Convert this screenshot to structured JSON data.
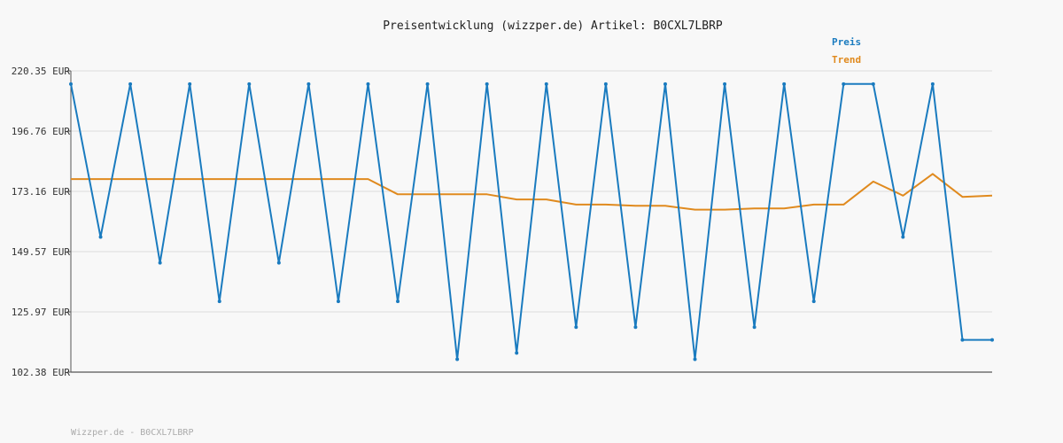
{
  "chart_data": {
    "type": "line",
    "title": "Preisentwicklung (wizzper.de) Artikel: B0CXL7LBRP",
    "footer": "Wizzper.de - B0CXL7LBRP",
    "ylim": [
      102.38,
      220.35
    ],
    "yticks": [
      "220.35 EUR",
      "196.76 EUR",
      "173.16 EUR",
      "149.57 EUR",
      "125.97 EUR",
      "102.38 EUR"
    ],
    "grid": true,
    "legend_position": "top-right",
    "series": [
      {
        "name": "Preis",
        "color": "#1a7bbf",
        "values": [
          215.2,
          155.3,
          215.2,
          145.2,
          215.2,
          130.1,
          215.2,
          145.2,
          215.2,
          130.1,
          215.2,
          130.1,
          215.2,
          107.4,
          215.2,
          109.9,
          215.2,
          120.0,
          215.2,
          120.0,
          215.2,
          107.4,
          215.2,
          120.0,
          215.2,
          130.1,
          215.2,
          215.2,
          155.3,
          215.2,
          115.0,
          115.0
        ]
      },
      {
        "name": "Trend",
        "color": "#e08a1e",
        "values": [
          178.0,
          178.0,
          178.0,
          178.0,
          178.0,
          178.0,
          178.0,
          178.0,
          178.0,
          178.0,
          178.0,
          172.0,
          172.0,
          172.0,
          172.0,
          170.0,
          170.0,
          168.0,
          168.0,
          167.5,
          167.5,
          166.0,
          166.0,
          166.5,
          166.5,
          168.0,
          168.0,
          177.0,
          171.5,
          180.0,
          171.0,
          171.5
        ]
      }
    ]
  }
}
